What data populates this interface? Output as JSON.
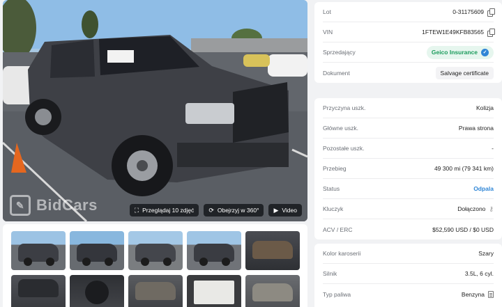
{
  "gallery": {
    "watermark": "BidCars",
    "actions": [
      {
        "icon": "gallery-icon",
        "label": "Przeglądaj 10 zdjęć"
      },
      {
        "icon": "360-icon",
        "label": "Obejrzyj w 360°"
      },
      {
        "icon": "play-icon",
        "label": "Video"
      }
    ],
    "thumb_count": 10
  },
  "lot_info": {
    "lot_label": "Lot",
    "lot_value": "0-31175609",
    "vin_label": "VIN",
    "vin_value": "1FTEW1E49KFB83565",
    "seller_label": "Sprzedający",
    "seller_value": "Geico Insurance",
    "document_label": "Dokument",
    "document_value": "Salvage certificate"
  },
  "damage_info": {
    "cause_label": "Przyczyna uszk.",
    "cause_value": "Kolizja",
    "primary_label": "Główne uszk.",
    "primary_value": "Prawa strona",
    "secondary_label": "Pozostałe uszk.",
    "secondary_value": "-",
    "mileage_label": "Przebieg",
    "mileage_value": "49 300 mi (79 341 km)",
    "status_label": "Status",
    "status_value": "Odpala",
    "key_label": "Kluczyk",
    "key_value": "Dołączono",
    "acv_label": "ACV / ERC",
    "acv_value": "$52,590 USD / $0 USD"
  },
  "vehicle_info": {
    "color_label": "Kolor karoserii",
    "color_value": "Szary",
    "engine_label": "Silnik",
    "engine_value": "3.5L, 6 cyl.",
    "fuel_label": "Typ paliwa",
    "fuel_value": "Benzyna"
  },
  "colors": {
    "seller_green": "#1a9b5b",
    "status_blue": "#2f86d6"
  }
}
